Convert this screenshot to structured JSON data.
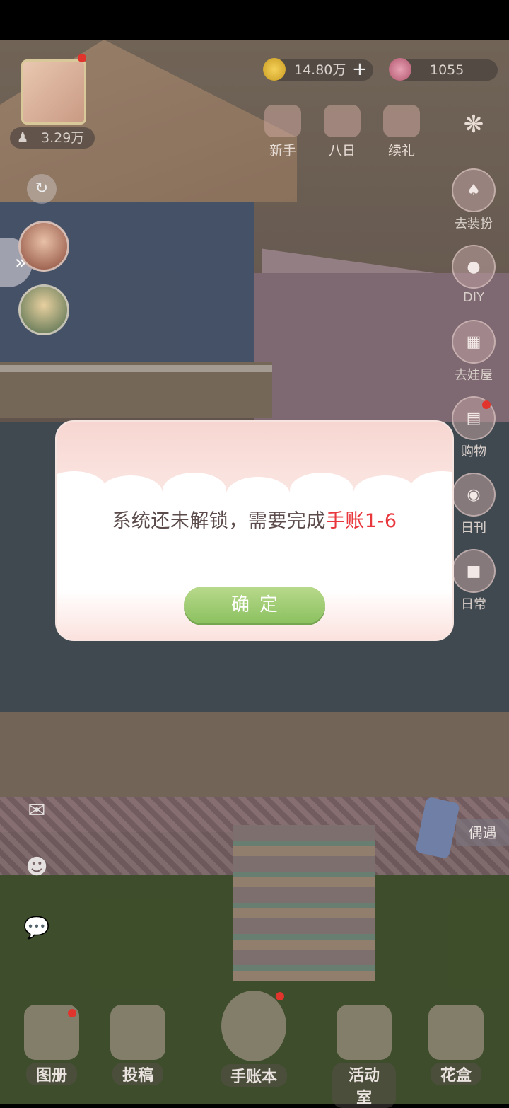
{
  "hud": {
    "avatar_level": "3.29万",
    "coins": "14.80万",
    "gems": "1055",
    "top_icons": [
      {
        "label": "新手"
      },
      {
        "label": "八日"
      },
      {
        "label": "续礼"
      }
    ],
    "side_icons": [
      {
        "label": "去装扮"
      },
      {
        "label": "DIY"
      },
      {
        "label": "去娃屋"
      },
      {
        "label": "购物"
      },
      {
        "label": "日刊"
      },
      {
        "label": "日常"
      }
    ],
    "bottom_bar": [
      {
        "label": "图册"
      },
      {
        "label": "投稿"
      },
      {
        "label": "手账本"
      },
      {
        "label": "活动室"
      },
      {
        "label": "花盒"
      }
    ],
    "meet_label": "偶遇",
    "colors": {
      "notify": "#e0342c",
      "confirm": "#8cc160",
      "highlight": "#e8383d"
    }
  },
  "dialog": {
    "message_prefix": "系统还未解锁，需要完成",
    "message_highlight": "手账1-6",
    "confirm_label": "确定"
  }
}
